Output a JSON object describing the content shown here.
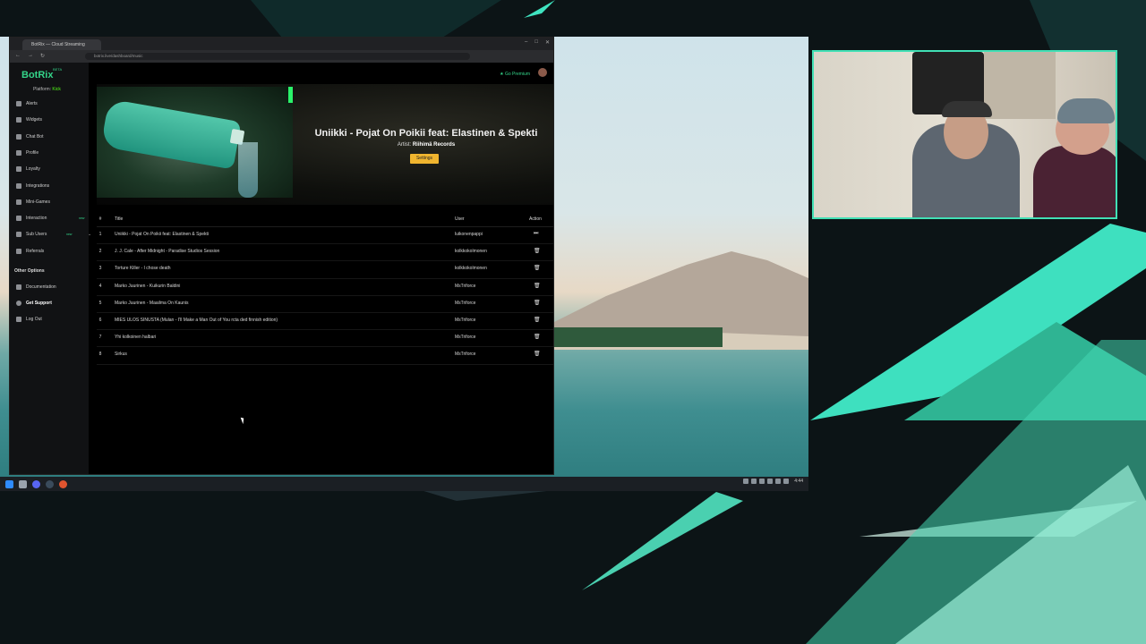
{
  "browser": {
    "tab_title": "BotRix — Cloud Streaming",
    "url": "botrix.live/dashboard/music"
  },
  "app": {
    "logo": "BotRix",
    "logo_badge": "BETA",
    "platform_label": "Platform:",
    "platform_value": "Kick",
    "premium_label": "Go Premium",
    "nav": [
      {
        "label": "Alerts",
        "icon": "bell-icon"
      },
      {
        "label": "Widgets",
        "icon": "grid-icon"
      },
      {
        "label": "Chat Bot",
        "icon": "chat-icon"
      },
      {
        "label": "Profile",
        "icon": "user-icon"
      },
      {
        "label": "Loyalty",
        "icon": "heart-icon"
      },
      {
        "label": "Integrations",
        "icon": "plug-icon"
      },
      {
        "label": "Mini-Games",
        "icon": "gamepad-icon"
      },
      {
        "label": "Interaction",
        "icon": "hand-icon",
        "badge": "new"
      },
      {
        "label": "Sub Users",
        "icon": "users-icon",
        "badge": "new"
      },
      {
        "label": "Referrals",
        "icon": "share-icon"
      }
    ],
    "other_options_title": "Other Options",
    "other_nav": [
      {
        "label": "Documentation",
        "icon": "book-icon"
      },
      {
        "label": "Get Support",
        "icon": "support-icon"
      },
      {
        "label": "Log Out",
        "icon": "logout-icon"
      }
    ]
  },
  "now_playing": {
    "title": "Uniikki - Pojat On Poikii feat: Elastinen & Spekti",
    "artist_label": "Artist:",
    "artist": "Riihimä Records",
    "settings_label": "Settings"
  },
  "queue": {
    "columns": {
      "num": "#",
      "title": "Title",
      "user": "User",
      "action": "Action"
    },
    "rows": [
      {
        "num": "1",
        "title": "Uniikki - Pojat On Poikii feat: Elastinen & Spekti",
        "user": "luikonenpappi",
        "action": "skip"
      },
      {
        "num": "2",
        "title": "J. J. Cale - After Midnight - Paradise Studios Session",
        "user": "kolkkokolmonen",
        "action": "delete"
      },
      {
        "num": "3",
        "title": "Torture Killer - I chose death",
        "user": "kolkkokolmonen",
        "action": "delete"
      },
      {
        "num": "4",
        "title": "Marko Juurinen - Kuikurin Baldini",
        "user": "MsTriforce",
        "action": "delete"
      },
      {
        "num": "5",
        "title": "Marko Juurinen - Maailma On Kaunis",
        "user": "MsTriforce",
        "action": "delete"
      },
      {
        "num": "6",
        "title": "MIES ULOS SINUSTA (Mulan - I'll Make a Man Out of You rcta ded finnish edition)",
        "user": "MsTriforce",
        "action": "delete"
      },
      {
        "num": "7",
        "title": "Yhi kolkoinen halbari",
        "user": "MsTriforce",
        "action": "delete"
      },
      {
        "num": "8",
        "title": "Sirkus",
        "user": "MsTriforce",
        "action": "delete"
      }
    ]
  },
  "taskbar": {
    "clock": "4:44"
  },
  "colors": {
    "accent": "#34d58a",
    "kick_green": "#53fc18",
    "settings_button": "#f0b52f",
    "webcam_border": "#41e0b5"
  }
}
